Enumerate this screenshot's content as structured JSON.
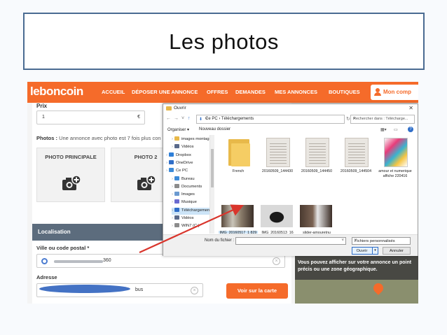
{
  "slide": {
    "title": "Les photos"
  },
  "site": {
    "logo": "leboncoin",
    "nav": [
      "ACCUEIL",
      "DÉPOSER UNE ANNONCE",
      "OFFRES",
      "DEMANDES",
      "MES ANNONCES",
      "BOUTIQUES"
    ],
    "account_label": "Mon comp",
    "colors": {
      "brand": "#f56b2a",
      "location_header": "#5c6c7d"
    }
  },
  "form": {
    "price_label": "Prix",
    "price_value": "1",
    "currency": "€",
    "photos_label": "Photos :",
    "photos_text": " Une annonce avec photo est 7 fois plus con",
    "photo_cards": [
      "PHOTO PRINCIPALE",
      "PHOTO 2"
    ],
    "location_header": "Localisation",
    "city_label": "Ville ou code postal *",
    "city_value_suffix": "360",
    "address_label": "Adresse",
    "address_value_suffix": "bus",
    "map_button": "Voir sur la carte",
    "map_hint": "Vous pouvez afficher sur votre annonce un point précis ou une zone géographique."
  },
  "dialog": {
    "title": "Ouvrir",
    "close": "✕",
    "breadcrumb": "Ce PC  ›  Téléchargements",
    "search_placeholder": "Rechercher dans : Télécharge...",
    "organize": "Organiser ▾",
    "new_folder": "Nouveau dossier",
    "tree": [
      {
        "label": "images montagr",
        "icon_color": "#e8b94a",
        "indent": 1
      },
      {
        "label": "Vidéos",
        "icon_color": "#5a6a8a",
        "indent": 1
      },
      {
        "label": "Dropbox",
        "icon_color": "#2f7fd8",
        "indent": 0
      },
      {
        "label": "OneDrive",
        "icon_color": "#2f6ec8",
        "indent": 0
      },
      {
        "label": "Ce PC",
        "icon_color": "#3c8ad8",
        "indent": 0
      },
      {
        "label": "Bureau",
        "icon_color": "#3c8ad8",
        "indent": 1
      },
      {
        "label": "Documents",
        "icon_color": "#8c8c8c",
        "indent": 1
      },
      {
        "label": "Images",
        "icon_color": "#6b9ad0",
        "indent": 1
      },
      {
        "label": "Musique",
        "icon_color": "#6b6bd0",
        "indent": 1
      },
      {
        "label": "Téléchargement",
        "icon_color": "#2f6ec8",
        "indent": 1,
        "selected": true
      },
      {
        "label": "Vidéos",
        "icon_color": "#5a6a8a",
        "indent": 1
      },
      {
        "label": "WIN7 (C:)",
        "icon_color": "#8c8c8c",
        "indent": 1
      }
    ],
    "files": [
      {
        "name": "French",
        "kind": "folder"
      },
      {
        "name": "20160509_144430",
        "kind": "doc"
      },
      {
        "name": "20160509_144450",
        "kind": "doc"
      },
      {
        "name": "20160509_144504",
        "kind": "doc"
      },
      {
        "name": "amour et numerique affiche 220416",
        "kind": "poster"
      },
      {
        "name": "IMG_20160517_1 829",
        "kind": "photo-room",
        "selected": true
      },
      {
        "name": "IMG_20160513_16 1745930_HDR",
        "kind": "photo-cable"
      },
      {
        "name": "slider-amouretnu merique",
        "kind": "photo-phone"
      }
    ],
    "filename_label": "Nom du fichier :",
    "filename_value": "",
    "filetype": "Fichiers personnalisés",
    "open_button": "Ouvrir",
    "cancel_button": "Annuler"
  }
}
